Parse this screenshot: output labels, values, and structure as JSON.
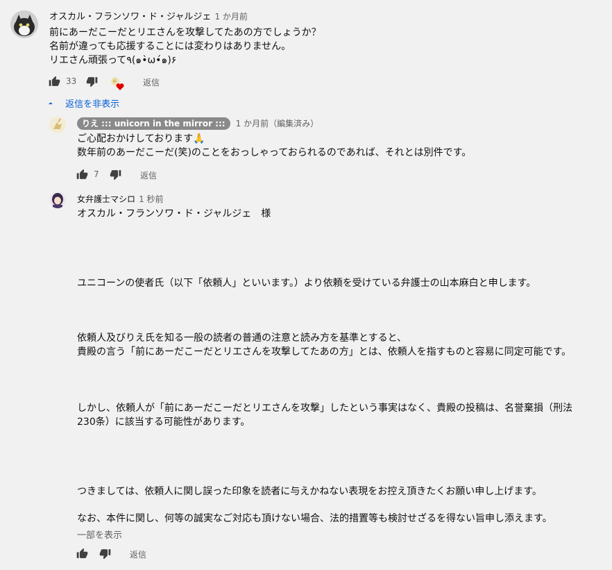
{
  "comment": {
    "author": "オスカル・フランソワ・ド・ジャルジェ",
    "time": "1 か月前",
    "text": "前にあーだこーだとリエさんを攻撃してたあの方でしょうか？\n名前が違っても応援することには変わりはありません。\nリエさん頑張って٩(๑•̀ω•́๑)۶",
    "likes": "33",
    "reply_label": "返信",
    "hide_replies_label": "返信を非表示"
  },
  "reply1": {
    "author": "りえ ::: unicorn in the mirror :::",
    "time": "1 か月前（編集済み）",
    "text": "ご心配おかけしております🙏\n数年前のあーだこーだ(笑)のことをおっしゃっておられるのであれば、それとは別件です。",
    "likes": "7",
    "reply_label": "返信"
  },
  "reply2": {
    "author": "女弁護士マシロ",
    "time": "1 秒前",
    "p1": "オスカル・フランソワ・ド・ジャルジェ　様",
    "p2": "ユニコーンの使者氏（以下「依頼人」といいます。）より依頼を受けている弁護士の山本麻白と申します。",
    "p3": "依頼人及びりえ氏を知る一般の読者の普通の注意と読み方を基準とすると、\n貴殿の言う「前にあーだこーだとリエさんを攻撃してたあの方」とは、依頼人を指すものと容易に同定可能です。",
    "p4": "しかし、依頼人が「前にあーだこーだとリエさんを攻撃」したという事実はなく、貴殿の投稿は、名誉棄損（刑法\n230条）に該当する可能性があります。",
    "p5": "つきましては、依頼人に関し誤った印象を読者に与えかねない表現をお控え頂きたくお願い申し上げます。",
    "p6": "なお、本件に関し、何等の誠実なご対応も頂けない場合、法的措置等も検討せざるを得ない旨申し添えます。",
    "show_less": "一部を表示",
    "reply_label": "返信"
  }
}
